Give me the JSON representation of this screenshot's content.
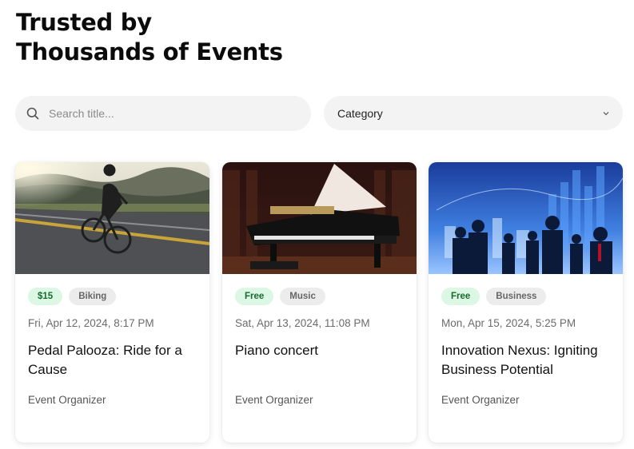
{
  "heading": {
    "line1": "Trusted by",
    "line2": "Thousands of Events"
  },
  "search": {
    "placeholder": "Search title...",
    "icon": "search-icon"
  },
  "category_select": {
    "label": "Category",
    "icon": "chevron-down-icon"
  },
  "events": [
    {
      "price": "$15",
      "category": "Biking",
      "date": "Fri, Apr 12, 2024, 8:17 PM",
      "title": "Pedal Palooza: Ride for a Cause",
      "organizer": "Event Organizer",
      "image": "cyclist-photo"
    },
    {
      "price": "Free",
      "category": "Music",
      "date": "Sat, Apr 13, 2024, 11:08 PM",
      "title": "Piano concert",
      "organizer": "Event Organizer",
      "image": "grand-piano-photo"
    },
    {
      "price": "Free",
      "category": "Business",
      "date": "Mon, Apr 15, 2024, 5:25 PM",
      "title": "Innovation Nexus: Igniting Business Potential",
      "organizer": "Event Organizer",
      "image": "business-people-photo"
    }
  ],
  "colors": {
    "price_tag_bg": "#dcf7e4",
    "price_tag_text": "#176b2f",
    "category_tag_bg": "#ececec",
    "input_bg": "#f3f3f3"
  }
}
